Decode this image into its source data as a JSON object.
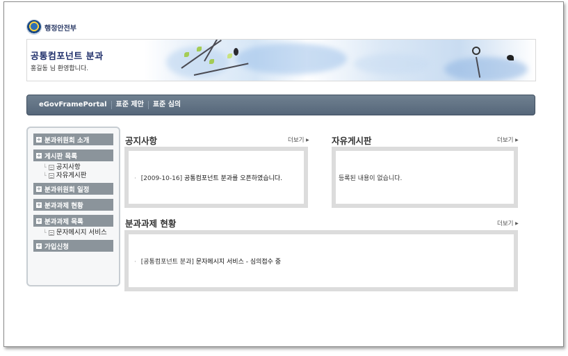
{
  "logo": {
    "org_name": "행정안전부",
    "emblem_icon": "government-emblem-icon"
  },
  "banner": {
    "title": "공통컴포넌트 분과",
    "greeting": "홍길동 님 환영합니다."
  },
  "nav": {
    "items": [
      "eGovFramePortal",
      "표준 제안",
      "표준 심의"
    ]
  },
  "sidebar": {
    "menu1": "분과위원회 소개",
    "menu2": "게시판 목록",
    "menu2_subs": [
      "공지사항",
      "자유게시판"
    ],
    "menu3": "분과위원회 일정",
    "menu4": "분과과제 현황",
    "menu5": "분과과제 목록",
    "menu5_subs": [
      "문자메시지 서비스"
    ],
    "menu6": "가입신청"
  },
  "notice": {
    "title": "공지사항",
    "more": "더보기",
    "items": [
      {
        "date": "[2009-10-16]",
        "text": "공통컴포넌트 분과를 오픈하였습니다."
      }
    ]
  },
  "freeboard": {
    "title": "자유게시판",
    "more": "더보기",
    "empty": "등록된 내용이 없습니다."
  },
  "tasks": {
    "title": "분과과제 현황",
    "more": "더보기",
    "items": [
      {
        "category": "[공통컴포넌트 분과]",
        "text": "문자메시지 서비스 - 심의접수 중"
      }
    ]
  }
}
